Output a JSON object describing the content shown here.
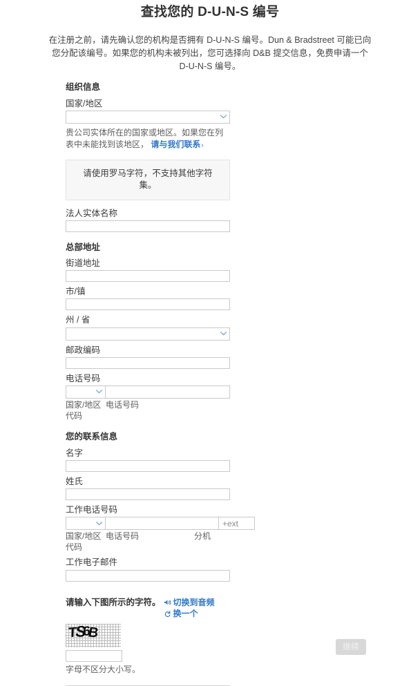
{
  "header": {
    "title": "查找您的 D-U-N-S 编号",
    "intro": "在注册之前，请先确认您的机构是否拥有 D-U-N-S 编号。Dun & Bradstreet 可能已向您分配该编号。如果您的机构未被列出，您可选择向 D&B 提交信息，免费申请一个 D-U-N-S 编号。"
  },
  "organization": {
    "heading": "组织信息",
    "country": {
      "label": "国家/地区",
      "value": "",
      "help_prefix": "贵公司实体所在的国家或地区。如果您在列表中未能找到该地区，",
      "help_link": "请与我们联系",
      "help_link_chevron": "›"
    },
    "notice": "请使用罗马字符，不支持其他字符集。",
    "legal_entity_name": {
      "label": "法人实体名称",
      "value": "",
      "placeholder": ""
    }
  },
  "headquarters": {
    "heading": "总部地址",
    "street": {
      "label": "街道地址",
      "value": "",
      "placeholder": ""
    },
    "city": {
      "label": "市/镇",
      "value": "",
      "placeholder": ""
    },
    "state": {
      "label": "州 / 省",
      "value": ""
    },
    "postal_code": {
      "label": "邮政编码",
      "value": "",
      "placeholder": ""
    },
    "phone": {
      "label": "电话号码",
      "country_code_value": "",
      "number_value": "",
      "number_placeholder": "",
      "caption_code": "国家/地区代码",
      "caption_number": "电话号码"
    }
  },
  "contact": {
    "heading": "您的联系信息",
    "first_name": {
      "label": "名字",
      "value": "",
      "placeholder": ""
    },
    "last_name": {
      "label": "姓氏",
      "value": "",
      "placeholder": ""
    },
    "work_phone": {
      "label": "工作电话号码",
      "country_code_value": "",
      "number_value": "",
      "number_placeholder": "",
      "ext_value": "",
      "ext_placeholder": "+ext",
      "caption_code": "国家/地区代码",
      "caption_number": "电话号码",
      "caption_ext": "分机"
    },
    "work_email": {
      "label": "工作电子邮件",
      "value": "",
      "placeholder": ""
    }
  },
  "captcha": {
    "prompt": "请输入下图所示的字符。",
    "audio_action": "切换到音频",
    "refresh_action": "换一个",
    "image_characters": "TS6B",
    "input_value": "",
    "input_placeholder": "",
    "hint": "字母不区分大小写。"
  },
  "footer": {
    "continue_label": "继续"
  },
  "colors": {
    "link": "#2f77c9",
    "chevron": "#7aa8d4",
    "border": "#c9c9c9",
    "notice_bg": "#f7f7f7",
    "button_disabled_bg": "#d8d8d8"
  }
}
